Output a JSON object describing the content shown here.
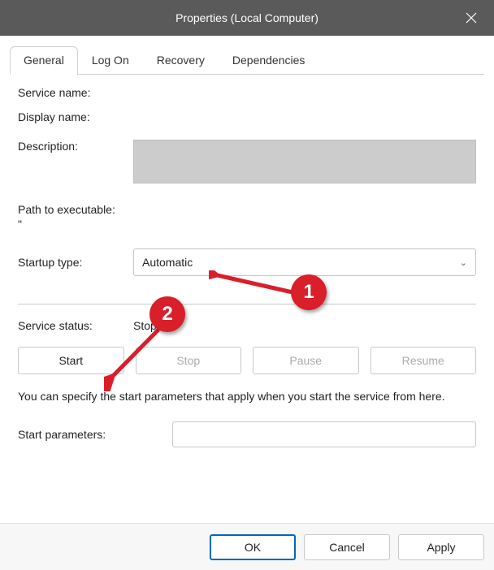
{
  "window": {
    "title": "Properties (Local Computer)"
  },
  "tabs": {
    "general": "General",
    "logon": "Log On",
    "recovery": "Recovery",
    "dependencies": "Dependencies"
  },
  "labels": {
    "service_name": "Service name:",
    "display_name": "Display name:",
    "description": "Description:",
    "path_to_exe": "Path to executable:",
    "startup_type": "Startup type:",
    "service_status": "Service status:",
    "start_params": "Start parameters:"
  },
  "values": {
    "service_name": "",
    "display_name": "",
    "description": "",
    "path_to_exe": "\"",
    "startup_type": "Automatic",
    "service_status": "Stopped",
    "start_params": ""
  },
  "buttons": {
    "start": "Start",
    "stop": "Stop",
    "pause": "Pause",
    "resume": "Resume",
    "ok": "OK",
    "cancel": "Cancel",
    "apply": "Apply"
  },
  "hint": "You can specify the start parameters that apply when you start the service from here.",
  "annotations": {
    "a1": "1",
    "a2": "2"
  }
}
